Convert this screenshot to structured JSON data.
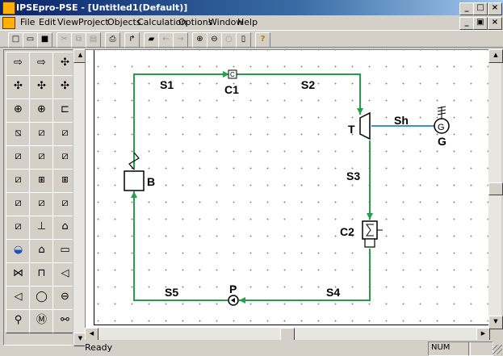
{
  "window": {
    "title": "IPSEpro-PSE - [Untitled1(Default)]"
  },
  "title_buttons": {
    "minimize": "_",
    "restore": "□",
    "close": "×"
  },
  "doc_buttons": {
    "minimize": "_",
    "restore": "▣",
    "close": "×"
  },
  "menu": [
    "File",
    "Edit",
    "View",
    "Project",
    "Objects",
    "Calculation",
    "Options",
    "Window",
    "Help"
  ],
  "toolbar": [
    "new",
    "open",
    "save",
    "cut",
    "copy",
    "paste",
    "print",
    "run",
    "open-project",
    "back",
    "forward",
    "zoom-in",
    "zoom-out",
    "zoom-fit",
    "page",
    "help"
  ],
  "diagram": {
    "stream_color": "#22a04a",
    "shaft_color": "#3a8fd8",
    "labels": {
      "s1": "S1",
      "s2": "S2",
      "s3": "S3",
      "s4": "S4",
      "s5": "S5",
      "sh": "Sh",
      "c1": "C1",
      "t": "T",
      "g": "G",
      "c2": "C2",
      "p": "P",
      "b": "B"
    },
    "c1_symbol": "C",
    "g_symbol": "G"
  },
  "status": {
    "text": "Ready",
    "num": "NUM"
  }
}
